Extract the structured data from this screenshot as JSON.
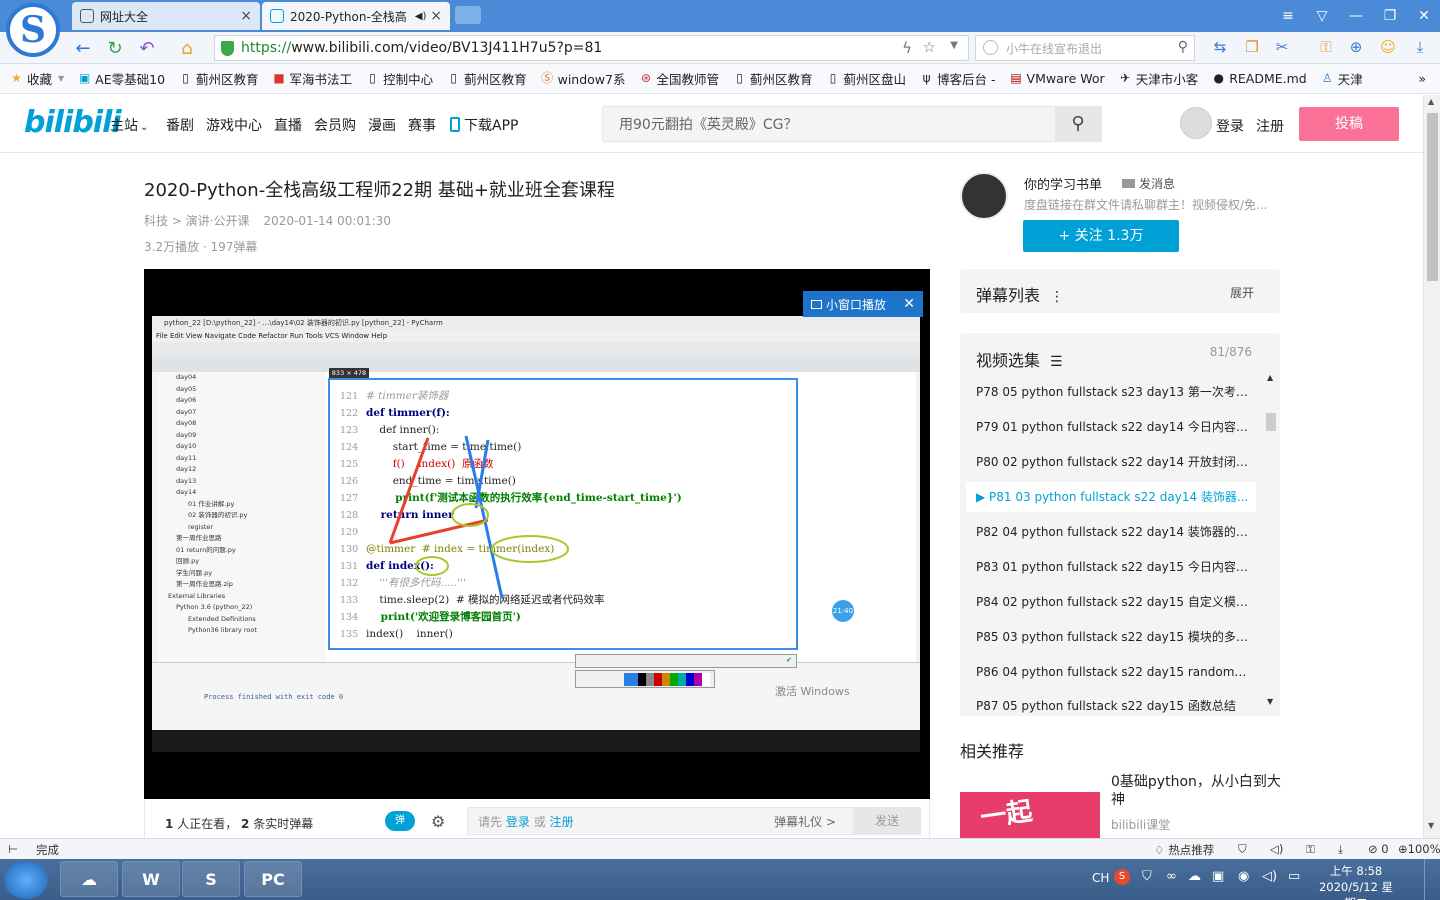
{
  "browser": {
    "tabs": [
      {
        "label": "网址大全",
        "close": "×"
      },
      {
        "label": "2020-Python-全栈高",
        "close": "×"
      }
    ],
    "url": "https://www.bilibili.com/video/BV13J411H7u5?p=81",
    "url_scheme": "https://",
    "url_rest": "www.bilibili.com/video/BV13J411H7u5?p=81",
    "search_placeholder": "小牛在线宣布退出",
    "bookmarks": [
      "收藏",
      "AE零基础10",
      "蓟州区教育",
      "军海书法工",
      "控制中心",
      "蓟州区教育",
      "window7系",
      "全国教师管",
      "蓟州区教育",
      "蓟州区盘山",
      "博客后台 -",
      "VMware Wor",
      "天津市小客",
      "README.md",
      "天津"
    ]
  },
  "bili": {
    "logo": "bilibili",
    "nav": [
      "主站",
      "番剧",
      "游戏中心",
      "直播",
      "会员购",
      "漫画",
      "赛事",
      "下载APP"
    ],
    "search_placeholder": "用90元翻拍《英灵殿》CG？",
    "login": "登录",
    "register": "注册",
    "upload": "投稿"
  },
  "video": {
    "title": "2020-Python-全栈高级工程师22期 基础+就业班全套课程",
    "category": "科技 > 演讲·公开课",
    "date": "2020-01-14 00:01:30",
    "stats": "3.2万播放 · 197弹幕",
    "mini_player": "小窗口播放",
    "viewers_count": "1",
    "viewers_text": "人正在看，",
    "danmaku_count": "2",
    "danmaku_text": "条实时弹幕",
    "dm_toggle": "弹",
    "dm_prompt": "请先",
    "dm_login": "登录",
    "dm_or": "或",
    "dm_register": "注册",
    "dm_etiquette": "弹幕礼仪 >",
    "dm_send": "发送"
  },
  "screen_content": {
    "ide_title": "python_22 [D:\\python_22] - ...\\day14\\02 装饰器的初识.py [python_22] - PyCharm",
    "ide_menu": "File  Edit  View  Navigate  Code  Refactor  Run  Tools  VCS  Window  Help",
    "tree": [
      "day04",
      "day05",
      "day06",
      "day07",
      "day08",
      "day09",
      "day10",
      "day11",
      "day12",
      "day13",
      "day14",
      "01 作业讲解.py",
      "02 装饰器的初识.py",
      "register",
      "第一周作业思路",
      "01 return的问题.py",
      "回顾.py",
      "学生问题.py",
      "第一周作业思路.zip",
      "External Libraries",
      "Python 3.6 (python_22)",
      "Extended Definitions",
      "Python36 library root"
    ],
    "size_badge": "833 × 478",
    "code": [
      {
        "ln": "121",
        "text": "# timmer装饰器"
      },
      {
        "ln": "122",
        "text": "def timmer(f):"
      },
      {
        "ln": "123",
        "text": "    def inner():"
      },
      {
        "ln": "124",
        "text": "        start_time = time.time()"
      },
      {
        "ln": "125",
        "text": "        f()    index()  原函数"
      },
      {
        "ln": "126",
        "text": "        end_time = time.time()"
      },
      {
        "ln": "127",
        "text": "        print(f'测试本函数的执行效率{end_time-start_time}')"
      },
      {
        "ln": "128",
        "text": "    return inner"
      },
      {
        "ln": "129",
        "text": ""
      },
      {
        "ln": "130",
        "text": "@timmer  # index = timmer(index)"
      },
      {
        "ln": "131",
        "text": "def index():"
      },
      {
        "ln": "132",
        "text": "    '''有很多代码.....'''"
      },
      {
        "ln": "133",
        "text": "    time.sleep(2)  # 模拟的网络延迟或者代码效率"
      },
      {
        "ln": "134",
        "text": "    print('欢迎登录博客园首页')"
      },
      {
        "ln": "135",
        "text": "index()    inner()"
      }
    ],
    "run_output": "Process finished with exit code 0",
    "watermark": "激活 Windows",
    "time_badge": "21:40"
  },
  "sidebar": {
    "up_name": "你的学习书单",
    "up_msg": "发消息",
    "up_desc": "度盘链接在群文件请私聊群主！视频侵权/免...",
    "follow": "+ 关注 1.3万",
    "dm_list": "弹幕列表",
    "dm_list_open": "展开",
    "playlist_title": "视频选集",
    "playlist_count": "81/876",
    "episodes": [
      {
        "label": "P78  05 python fullstack s23 day13 第一次考试..."
      },
      {
        "label": "P79  01 python fullstack s22 day14 今日内容大..."
      },
      {
        "label": "P80  02 python fullstack s22 day14 开放封闭原..."
      },
      {
        "label": "▶ P81  03 python fullstack s22 day14 装饰器..."
      },
      {
        "label": "P82  04 python fullstack s22 day14 装饰器的应用"
      },
      {
        "label": "P83  01 python fullstack s22 day15 今日内容大..."
      },
      {
        "label": "P84  02 python fullstack s22 day15 自定义模块..."
      },
      {
        "label": "P85  03 python fullstack s22 day15 模块的多种..."
      },
      {
        "label": "P86  04 python fullstack s22 day15 random模..."
      },
      {
        "label": "P87  05 python fullstack s22 day15 函数总结"
      }
    ],
    "related_title": "相关推荐",
    "related_name": "0基础python，从小白到大神",
    "related_author": "bilibili课堂",
    "related_thumb_text": "一起"
  },
  "status": {
    "left": "完成",
    "hot": "热点推荐",
    "zoom": "100%",
    "counter": "0"
  },
  "taskbar": {
    "time": "上午 8:58",
    "date": "2020/5/12 星期二",
    "lang": "CH"
  },
  "colors": {
    "bili_blue": "#00a1d6",
    "bili_pink": "#fb7299",
    "browser_blue": "#4a8ad6"
  }
}
